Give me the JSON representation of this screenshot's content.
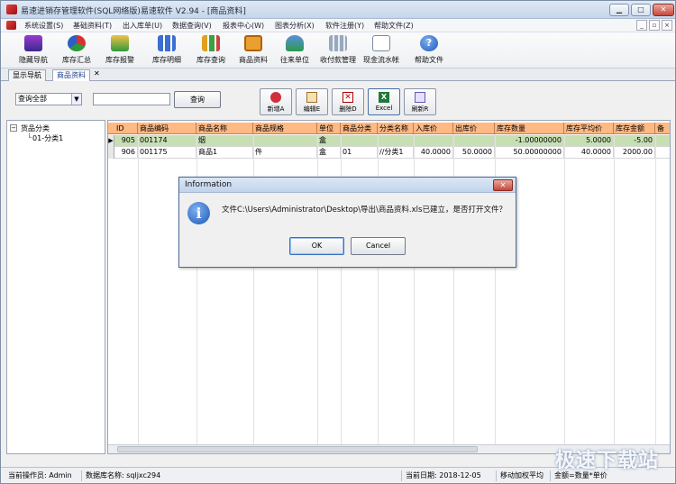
{
  "window": {
    "title": "易速进销存管理软件(SQL网络版)易速软件 V2.94 - [商品资料]"
  },
  "menu": [
    "系统设置(S)",
    "基础资料(T)",
    "出入库单(U)",
    "数据查询(V)",
    "报表中心(W)",
    "图表分析(X)",
    "软件注册(Y)",
    "帮助文件(Z)"
  ],
  "toolbar": [
    "隐藏导航",
    "库存汇总",
    "库存报警",
    "库存明细",
    "库存查询",
    "商品资料",
    "往来单位",
    "收付款管理",
    "现金流水帐",
    "帮助文件"
  ],
  "tabs": [
    "显示导航",
    "商品资料"
  ],
  "filter": {
    "select_value": "查询全部",
    "query_label": "查询"
  },
  "actions": [
    "新增A",
    "编辑E",
    "删除D",
    "Excel",
    "刷新R"
  ],
  "tree": {
    "root": "货品分类",
    "child": "01-分类1"
  },
  "grid": {
    "columns": [
      "ID",
      "商品编码",
      "商品名称",
      "商品规格",
      "单位",
      "商品分类",
      "分类名称",
      "入库价",
      "出库价",
      "库存数量",
      "库存平均价",
      "库存金额",
      "备"
    ],
    "rows": [
      [
        "905",
        "001174",
        "烟",
        "",
        "盒",
        "",
        "",
        "",
        "",
        "-1.00000000",
        "5.0000",
        "-5.00",
        ""
      ],
      [
        "906",
        "001175",
        "商品1",
        "件",
        "盒",
        "01",
        "//分类1",
        "40.0000",
        "50.0000",
        "50.00000000",
        "40.0000",
        "2000.00",
        ""
      ]
    ]
  },
  "dialog": {
    "title": "Information",
    "message": "文件C:\\Users\\Administrator\\Desktop\\导出\\商品资料.xls已建立，是否打开文件？",
    "ok": "OK",
    "cancel": "Cancel"
  },
  "status": {
    "operator": "当前操作员: Admin",
    "database": "数据库名称: sqljxc294",
    "date": "当前日期: 2018-12-05",
    "method": "移动加权平均",
    "formula": "金额=数量*单价"
  },
  "watermark": "极速下载站"
}
